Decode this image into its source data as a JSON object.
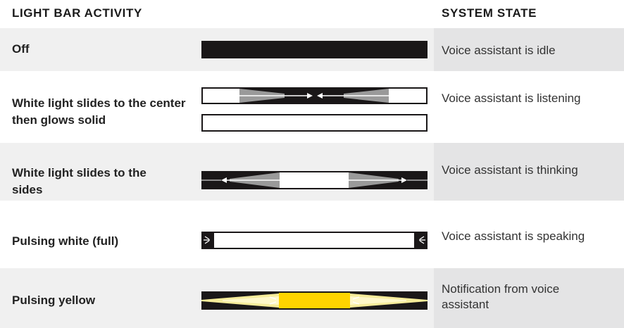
{
  "header": {
    "activity_label": "LIGHT BAR ACTIVITY",
    "state_label": "SYSTEM STATE"
  },
  "rows": [
    {
      "activity": "Off",
      "state": "Voice assistant is idle",
      "light_bar_icon": "off-bar-icon"
    },
    {
      "activity": "White light slides to the center then glows solid",
      "state": "Voice assistant is listening",
      "light_bar_icon": "slide-to-center-icon"
    },
    {
      "activity": "White light slides to the sides",
      "state": "Voice assistant is thinking",
      "light_bar_icon": "slide-to-sides-icon"
    },
    {
      "activity": "Pulsing white (full)",
      "state": "Voice assistant is speaking",
      "light_bar_icon": "pulsing-white-icon"
    },
    {
      "activity": "Pulsing yellow",
      "state": "Notification from voice assistant",
      "light_bar_icon": "pulsing-yellow-icon"
    }
  ],
  "colors": {
    "bar_black": "#1a1718",
    "light_white": "#ffffff",
    "glow_yellow": "#ffd400",
    "shaded_row": "#f0f0f0",
    "shaded_state_cell": "#e4e4e5"
  }
}
